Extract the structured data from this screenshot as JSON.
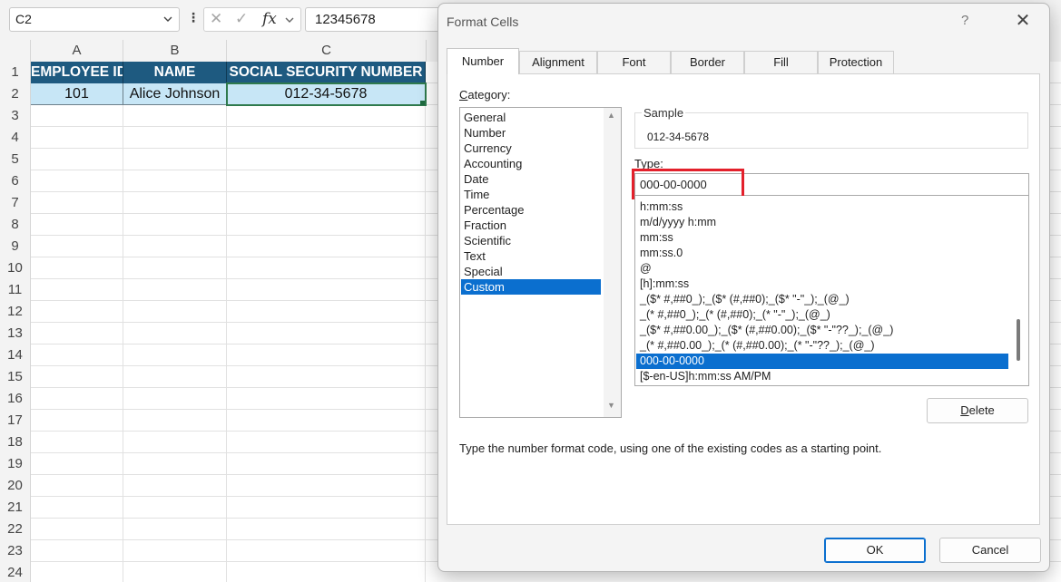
{
  "sheet": {
    "name_box": "C2",
    "formula_value": "12345678",
    "columns": [
      "A",
      "B",
      "C"
    ],
    "rows": [
      "1",
      "2",
      "3",
      "4",
      "5",
      "6",
      "7",
      "8",
      "9",
      "10",
      "11",
      "12",
      "13",
      "14",
      "15",
      "16",
      "17",
      "18",
      "19",
      "20",
      "21",
      "22",
      "23",
      "24"
    ],
    "header_row": [
      "EMPLOYEE ID",
      "NAME",
      "SOCIAL SECURITY NUMBER"
    ],
    "data_row": [
      "101",
      "Alice Johnson",
      "012-34-5678"
    ],
    "colors": {
      "header_fill": "#1e5a80",
      "data_fill": "#c7e6f6"
    }
  },
  "dialog": {
    "title": "Format Cells",
    "help": "?",
    "close": "✕",
    "tabs": [
      "Number",
      "Alignment",
      "Font",
      "Border",
      "Fill",
      "Protection"
    ],
    "active_tab": "Number",
    "category_label": "Category:",
    "categories": [
      "General",
      "Number",
      "Currency",
      "Accounting",
      "Date",
      "Time",
      "Percentage",
      "Fraction",
      "Scientific",
      "Text",
      "Special",
      "Custom"
    ],
    "selected_category": "Custom",
    "sample_label": "Sample",
    "sample_value": "012-34-5678",
    "type_label": "Type:",
    "type_value": "000-00-0000",
    "formats": [
      "h:mm:ss",
      "m/d/yyyy h:mm",
      "mm:ss",
      "mm:ss.0",
      "@",
      "[h]:mm:ss",
      "_($* #,##0_);_($* (#,##0);_($* \"-\"_);_(@_)",
      "_(* #,##0_);_(* (#,##0);_(* \"-\"_);_(@_)",
      "_($* #,##0.00_);_($* (#,##0.00);_($* \"-\"??_);_(@_)",
      "_(* #,##0.00_);_(* (#,##0.00);_(* \"-\"??_);_(@_)",
      "000-00-0000",
      "[$-en-US]h:mm:ss AM/PM"
    ],
    "selected_format": "000-00-0000",
    "delete_label": "Delete",
    "hint": "Type the number format code, using one of the existing codes as a starting point.",
    "ok_label": "OK",
    "cancel_label": "Cancel",
    "highlight_color": "#e3202b"
  }
}
